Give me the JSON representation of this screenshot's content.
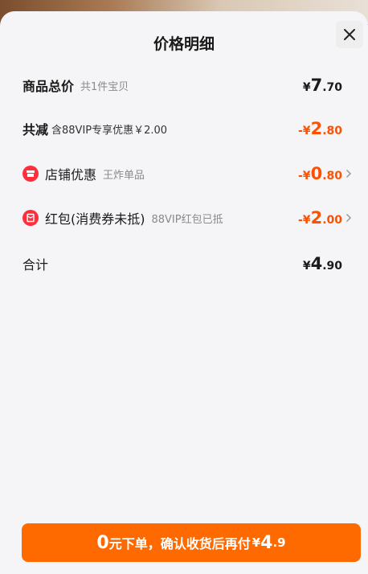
{
  "header": {
    "title": "价格明细",
    "close_icon": "close-icon"
  },
  "rows": [
    {
      "label": "商品总价",
      "sub": "共1件宝贝",
      "sign": "¥",
      "amount_int": "7",
      "amount_dec": ".70",
      "chevron": false
    },
    {
      "label": "共减",
      "sub": "含88VIP专享优惠￥2.00",
      "sign": "-¥",
      "amount_int": "2",
      "amount_dec": ".80",
      "chevron": false
    },
    {
      "label": "店铺优惠",
      "sub": "王炸单品",
      "sign": "-¥",
      "amount_int": "0",
      "amount_dec": ".80",
      "chevron": true,
      "icon": "shop-coupon-icon"
    },
    {
      "label": "红包(消费券未抵)",
      "sub": "88VIP红包已抵",
      "sign": "-¥",
      "amount_int": "2",
      "amount_dec": ".00",
      "chevron": true,
      "icon": "red-envelope-icon"
    },
    {
      "label": "合计",
      "sign": "¥",
      "amount_int": "4",
      "amount_dec": ".90",
      "chevron": false
    }
  ],
  "cta": {
    "zero": "0",
    "text": "元下单，确认收货后再付",
    "yen": "¥",
    "price_int": "4",
    "price_dec": ".9"
  },
  "colors": {
    "accent": "#ff5000",
    "button": "#ff6a00",
    "badge": "#ff2e3d"
  }
}
